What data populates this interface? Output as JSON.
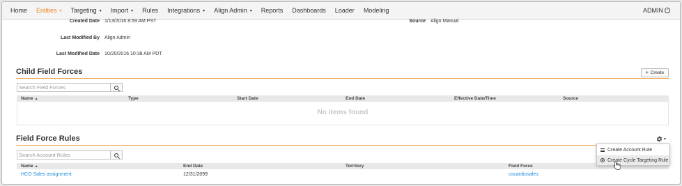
{
  "nav": {
    "items": [
      {
        "label": "Home",
        "active": false,
        "caret": false
      },
      {
        "label": "Entities",
        "active": true,
        "caret": true
      },
      {
        "label": "Targeting",
        "active": false,
        "caret": true
      },
      {
        "label": "Import",
        "active": false,
        "caret": true
      },
      {
        "label": "Rules",
        "active": false,
        "caret": false
      },
      {
        "label": "Integrations",
        "active": false,
        "caret": true
      },
      {
        "label": "Align Admin",
        "active": false,
        "caret": true
      },
      {
        "label": "Reports",
        "active": false,
        "caret": false
      },
      {
        "label": "Dashboards",
        "active": false,
        "caret": false
      },
      {
        "label": "Loader",
        "active": false,
        "caret": false
      },
      {
        "label": "Modeling",
        "active": false,
        "caret": false
      }
    ],
    "caret_glyph": "▾",
    "admin_label": "ADMIN",
    "accent_color": "#f0861f"
  },
  "details": {
    "created_date_label": "Created Date",
    "created_date_value": "1/13/2016 8:59 AM PST",
    "source_label": "Source",
    "source_value": "Align Manual",
    "last_modified_by_label": "Last Modified By",
    "last_modified_by_value": "Align Admin",
    "last_modified_date_label": "Last Modified Date",
    "last_modified_date_value": "10/20/2016 10:38 AM PDT"
  },
  "child_field_forces": {
    "title": "Child Field Forces",
    "create_label": "Create",
    "plus_glyph": "+",
    "search_placeholder": "Search Field Forces",
    "columns": [
      "Name",
      "Type",
      "Start Date",
      "End Date",
      "Effective Date/Time",
      "Source"
    ],
    "sort_glyph": "▲",
    "empty_text": "No items found"
  },
  "field_force_rules": {
    "title": "Field Force Rules",
    "search_placeholder": "Search Account Rules",
    "columns": [
      "Name",
      "End Date",
      "Territory",
      "Field Force"
    ],
    "rows": [
      {
        "name": "HCO Sales assignment",
        "end_date": "12/31/2099",
        "territory": "",
        "field_force": "uscardiosales"
      }
    ],
    "gear_caret": "▾",
    "menu": [
      {
        "label": "Create Account Rule",
        "icon": "list-icon",
        "hover": false
      },
      {
        "label": "Create Cycle Targeting Rule",
        "icon": "target-icon",
        "hover": true
      }
    ]
  }
}
